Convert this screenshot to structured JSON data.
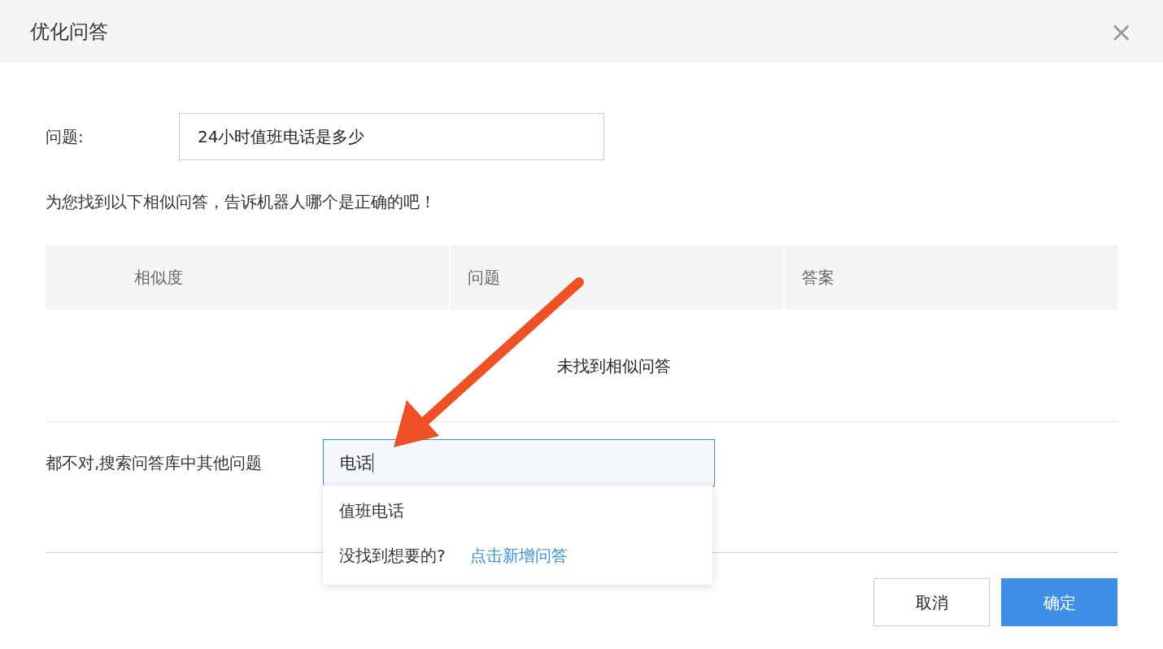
{
  "dialog": {
    "title": "优化问答",
    "close": "×"
  },
  "question": {
    "label": "问题:",
    "value": "24小时值班电话是多少"
  },
  "hint": "为您找到以下相似问答，告诉机器人哪个是正确的吧！",
  "table": {
    "columns": [
      "相似度",
      "问题",
      "答案"
    ],
    "empty_text": "未找到相似问答"
  },
  "search": {
    "label": "都不对,搜索问答库中其他问题",
    "value": "电话",
    "focused": true
  },
  "suggestions": {
    "items": [
      "值班电话"
    ],
    "not_found": "没找到想要的?",
    "add_link": "点击新增问答"
  },
  "buttons": [
    {
      "label": "取消",
      "kind": "secondary"
    },
    {
      "label": "确定",
      "kind": "primary"
    }
  ]
}
